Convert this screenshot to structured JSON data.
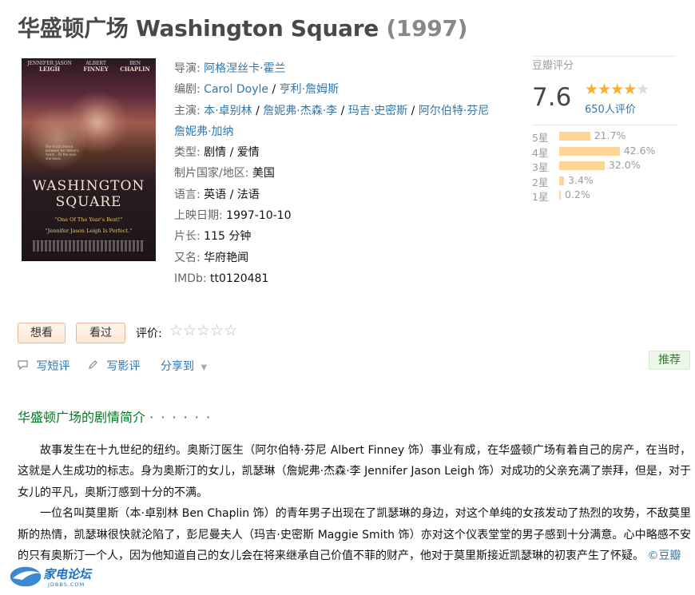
{
  "title": {
    "main": "华盛顿广场 Washington Square",
    "year": "(1997)"
  },
  "poster": {
    "credits": [
      {
        "first": "JENNIFER JASON",
        "last": "LEIGH"
      },
      {
        "first": "ALBERT",
        "last": "FINNEY"
      },
      {
        "first": "BEN",
        "last": "CHAPLIN"
      }
    ],
    "tagline": "She must choose between her father's heart... Or the man she loves.",
    "title_line1": "WASHINGTON",
    "title_line2": "SQUARE",
    "quote1": "\"One Of The Year's Best!\"",
    "quote2": "\"Jennifer Jason Leigh Is Perfect.\""
  },
  "info": {
    "director_label": "导演:",
    "director": "阿格涅丝卡·霍兰",
    "writer_label": "编剧:",
    "writers": [
      "Carol Doyle",
      "亨利·詹姆斯"
    ],
    "cast_label": "主演:",
    "cast": [
      "本·卓别林",
      "詹妮弗·杰森·李",
      "玛吉·史密斯",
      "阿尔伯特·芬尼",
      "詹妮弗·加纳"
    ],
    "genre_label": "类型:",
    "genre": "剧情 / 爱情",
    "country_label": "制片国家/地区:",
    "country": "美国",
    "language_label": "语言:",
    "language": "英语 / 法语",
    "release_label": "上映日期:",
    "release": "1997-10-10",
    "runtime_label": "片长:",
    "runtime": "115 分钟",
    "aka_label": "又名:",
    "aka": "华府艳闻",
    "imdb_label": "IMDb:",
    "imdb": "tt0120481"
  },
  "rating": {
    "header": "豆瓣评分",
    "score": "7.6",
    "stars_filled": 4,
    "votes": "650人评价",
    "distribution": [
      {
        "label": "5星",
        "percent": 21.7,
        "text": "21.7%"
      },
      {
        "label": "4星",
        "percent": 42.6,
        "text": "42.6%"
      },
      {
        "label": "3星",
        "percent": 32.0,
        "text": "32.0%"
      },
      {
        "label": "2星",
        "percent": 3.4,
        "text": "3.4%"
      },
      {
        "label": "1星",
        "percent": 0.2,
        "text": "0.2%"
      }
    ]
  },
  "actions": {
    "want": "想看",
    "seen": "看过",
    "rate_label": "评价:",
    "short_review": "写短评",
    "review": "写影评",
    "share": "分享到",
    "recommend": "推荐"
  },
  "summary": {
    "heading": "华盛顿广场的剧情简介",
    "dots": "· · · · · ·",
    "paragraphs": [
      "故事发生在十九世纪的纽约。奥斯汀医生（阿尔伯特·芬尼 Albert Finney 饰）事业有成，在华盛顿广场有着自己的房产，在当时，这就是人生成功的标志。身为奥斯汀的女儿，凯瑟琳（詹妮弗·杰森·李 Jennifer Jason Leigh 饰）对成功的父亲充满了崇拜，但是，对于女儿的平凡，奥斯汀感到十分的不满。",
      "一位名叫莫里斯（本·卓别林 Ben Chaplin 饰）的青年男子出现在了凯瑟琳的身边，对这个单纯的女孩发动了热烈的攻势，不敌莫里斯的热情，凯瑟琳很快就沦陷了，彭尼曼夫人（玛吉·史密斯 Maggie Smith 饰）亦对这个仪表堂堂的男子感到十分满意。心中略感不安的只有奥斯汀一个人，因为他知道自己的女儿会在将来继承自己价值不菲的财产，他对于莫里斯接近凯瑟琳的初衷产生了怀疑。"
    ],
    "source": "©豆瓣"
  },
  "watermark": {
    "text": "家电论坛",
    "sub": "JDBBS.COM"
  },
  "colors": {
    "link": "#3377aa",
    "star": "#ffac2d",
    "bar": "#ffd596",
    "section": "#007722"
  }
}
